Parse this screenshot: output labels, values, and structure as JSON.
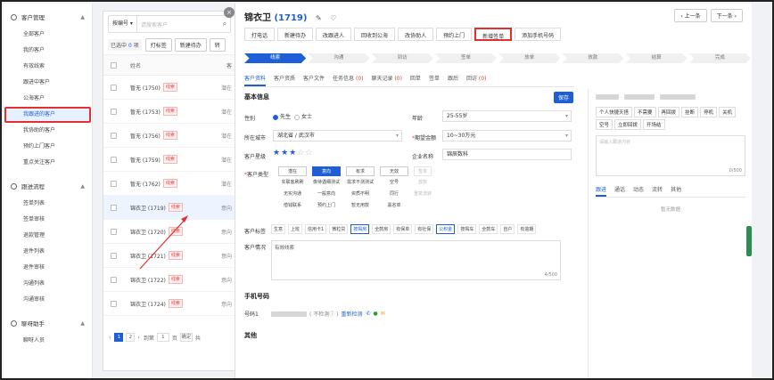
{
  "sidebar": {
    "groups": [
      {
        "label": "客户管理",
        "items": [
          "全部客户",
          "我的客户",
          "有效线索",
          "跟进中客户",
          "公海客户",
          "我跟进的客户",
          "我协助的客户",
          "预约上门客户",
          "重点关注客户"
        ]
      },
      {
        "label": "跟进流程",
        "items": [
          "签单列表",
          "签单审核",
          "退款管理",
          "退件列表",
          "退件审核",
          "沟通列表",
          "沟通审核"
        ]
      },
      {
        "label": "聊呀助手",
        "items": [
          "聊呀人员"
        ]
      }
    ]
  },
  "list": {
    "search_select": "按编号",
    "search_placeholder": "请搜索客户",
    "selected_prefix": "已选中",
    "selected_count": "0",
    "selected_suffix": "项",
    "btn_tag": "打标签",
    "btn_new": "新建待办",
    "btn_more": "转",
    "col_name": "姓名",
    "col_next": "客",
    "rows": [
      {
        "name": "暂无 (1750)",
        "tag": "线索",
        "trail": "潜在"
      },
      {
        "name": "暂无 (1753)",
        "tag": "线索",
        "trail": "潜在"
      },
      {
        "name": "暂无 (1756)",
        "tag": "线索",
        "trail": "潜在"
      },
      {
        "name": "暂无 (1759)",
        "tag": "线索",
        "trail": "潜在"
      },
      {
        "name": "暂无 (1762)",
        "tag": "线索",
        "trail": "潜在"
      },
      {
        "name": "锦衣卫 (1719)",
        "tag": "线索",
        "trail": "意向"
      },
      {
        "name": "锦衣卫 (1720)",
        "tag": "线索",
        "trail": "意向"
      },
      {
        "name": "锦衣卫 (1721)",
        "tag": "线索",
        "trail": "意向"
      },
      {
        "name": "锦衣卫 (1722)",
        "tag": "线索",
        "trail": "意向"
      },
      {
        "name": "锦衣卫 (1724)",
        "tag": "线索",
        "trail": "意向"
      }
    ],
    "pager": {
      "pages": [
        "1",
        "2"
      ],
      "current": "1",
      "goto_label": "到第",
      "goto_value": "1",
      "page_unit": "页",
      "confirm": "确定",
      "total": "共"
    }
  },
  "detail": {
    "title_name": "锦衣卫",
    "title_id": "(1719)",
    "prev_label": "上一条",
    "next_label": "下一条",
    "actions": [
      "打电话",
      "新建待办",
      "改跟进人",
      "回收到公海",
      "改协助人",
      "预约上门",
      "新增签单",
      "添加手机号码"
    ],
    "highlighted_action": "新增签单",
    "stages": [
      "线索",
      "沟通",
      "到访",
      "签单",
      "放单",
      "放款",
      "结算",
      "完成"
    ],
    "current_stage": "线索",
    "tabs": [
      {
        "label": "客户资料",
        "count": ""
      },
      {
        "label": "客户资质",
        "count": ""
      },
      {
        "label": "客户文件",
        "count": ""
      },
      {
        "label": "任务信息",
        "count": "(0)"
      },
      {
        "label": "聊天记录",
        "count": "(0)"
      },
      {
        "label": "回单",
        "count": ""
      },
      {
        "label": "签单",
        "count": ""
      },
      {
        "label": "跟后",
        "count": ""
      },
      {
        "label": "回访",
        "count": "(0)"
      }
    ],
    "basic_info_title": "基本信息",
    "save_label": "保存",
    "gender_label": "性别",
    "gender_male": "先生",
    "gender_female": "女士",
    "age_label": "年龄",
    "age_value": "25-55岁",
    "city_label": "所在城市",
    "province_value": "湖北省",
    "city_value": "武汉市",
    "amount_label": "期望金额",
    "amount_value": "10~30万元",
    "star_label": "客户星级",
    "company_label": "企业名称",
    "company_value": "锦辰数科",
    "type_label": "客户类型",
    "type_grid": [
      [
        "潜在",
        "意向",
        "有求",
        "无效",
        "签单"
      ],
      [
        "实联客刷刷",
        "像待遇细测试",
        "需求不测测试",
        "空号",
        "放款"
      ],
      [
        "无实沟通",
        "一般意向",
        "资质不明",
        "同行",
        "重复流转"
      ],
      [
        "借钱联系",
        "预约上门",
        "暂无用款",
        "黑名单",
        ""
      ]
    ],
    "tags_label": "客户标签",
    "tags": [
      "生意",
      "上班",
      "信用卡1",
      "微粒贷",
      "按揭房",
      "全款房",
      "有保单",
      "有社保",
      "公积金",
      "按揭车",
      "全款车",
      "自户",
      "有逾期"
    ],
    "tags_on": [
      "按揭房",
      "公积金"
    ],
    "notes_label": "客户情况",
    "notes_value": "有效线索",
    "notes_count": "4/500",
    "phone_title": "手机号码",
    "phone_label": "号码1",
    "phone_status": "( 不检测 ",
    "phone_recheck": "重新检测",
    "other_title": "其他"
  },
  "right": {
    "quick_tags": [
      "个人快捷天搭",
      "不需要",
      "再回拨",
      "挂断",
      "停机",
      "关机",
      "空号",
      "立即回拨",
      "开场结"
    ],
    "note_placeholder": "请输入跟进内容",
    "note_count": "0/500",
    "tabs": [
      "跟进",
      "通话",
      "动态",
      "流转",
      "其他"
    ],
    "empty_text": "暂无数据"
  },
  "colors": {
    "primary": "#1f5fd6",
    "highlight": "#e03030",
    "tag_red": "#e04040",
    "scroll": "#2c8c52"
  }
}
